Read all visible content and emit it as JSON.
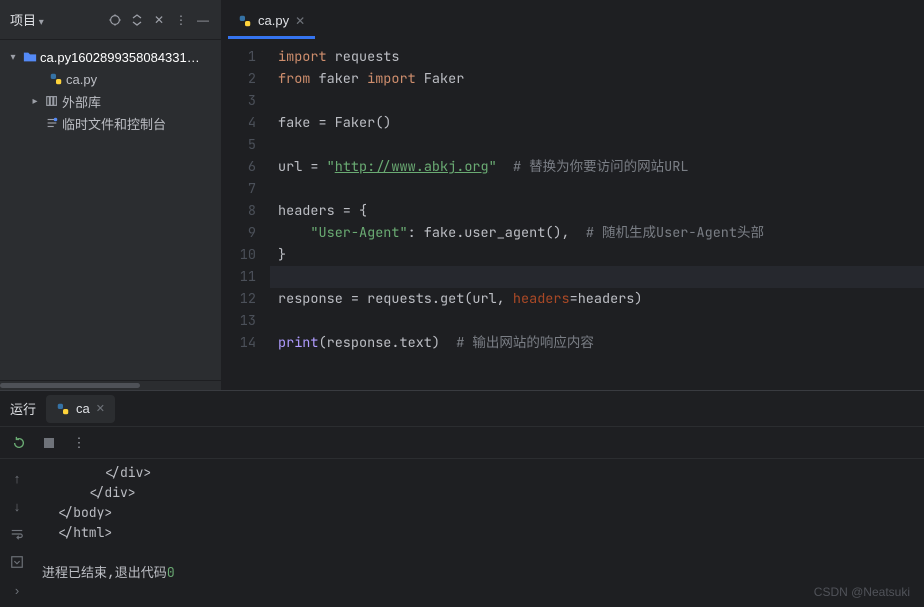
{
  "sidebar": {
    "title": "项目",
    "project_name": "ca.py1602899358084331…",
    "file_name": "ca.py",
    "external_libs": "外部库",
    "scratches": "临时文件和控制台"
  },
  "tabs": {
    "active": "ca.py"
  },
  "code": {
    "lines": [
      {
        "n": 1,
        "segments": [
          {
            "t": "import ",
            "c": "kw"
          },
          {
            "t": "requests",
            "c": "id"
          }
        ]
      },
      {
        "n": 2,
        "segments": [
          {
            "t": "from ",
            "c": "kw"
          },
          {
            "t": "faker ",
            "c": "id"
          },
          {
            "t": "import ",
            "c": "kw"
          },
          {
            "t": "Faker",
            "c": "id"
          }
        ]
      },
      {
        "n": 3,
        "segments": []
      },
      {
        "n": 4,
        "segments": [
          {
            "t": "fake = Faker()",
            "c": "id"
          }
        ]
      },
      {
        "n": 5,
        "segments": []
      },
      {
        "n": 6,
        "segments": [
          {
            "t": "url = ",
            "c": "id"
          },
          {
            "t": "\"",
            "c": "str"
          },
          {
            "t": "http://www.abkj.org",
            "c": "url"
          },
          {
            "t": "\"",
            "c": "str"
          },
          {
            "t": "  ",
            "c": "id"
          },
          {
            "t": "# 替换为你要访问的网站URL",
            "c": "com"
          }
        ]
      },
      {
        "n": 7,
        "segments": []
      },
      {
        "n": 8,
        "segments": [
          {
            "t": "headers = {",
            "c": "id"
          }
        ]
      },
      {
        "n": 9,
        "segments": [
          {
            "t": "    ",
            "c": "id"
          },
          {
            "t": "\"User-Agent\"",
            "c": "str"
          },
          {
            "t": ": fake.user_agent(),  ",
            "c": "id"
          },
          {
            "t": "# 随机生成User-Agent头部",
            "c": "com"
          }
        ]
      },
      {
        "n": 10,
        "segments": [
          {
            "t": "}",
            "c": "id"
          }
        ]
      },
      {
        "n": 11,
        "segments": [],
        "current": true
      },
      {
        "n": 12,
        "segments": [
          {
            "t": "response = requests.get(url, ",
            "c": "id"
          },
          {
            "t": "headers",
            "c": "arg"
          },
          {
            "t": "=headers)",
            "c": "id"
          }
        ]
      },
      {
        "n": 13,
        "segments": []
      },
      {
        "n": 14,
        "segments": [
          {
            "t": "print",
            "c": "fn"
          },
          {
            "t": "(response.text)  ",
            "c": "id"
          },
          {
            "t": "# 输出网站的响应内容",
            "c": "com"
          }
        ]
      }
    ]
  },
  "run": {
    "title": "运行",
    "tab": "ca",
    "output": [
      "        </div>",
      "      </div>",
      "  </body>",
      "  </html>",
      "",
      "进程已结束,退出代码0"
    ],
    "exit_code": "0"
  },
  "watermark": "CSDN @Neatsuki"
}
